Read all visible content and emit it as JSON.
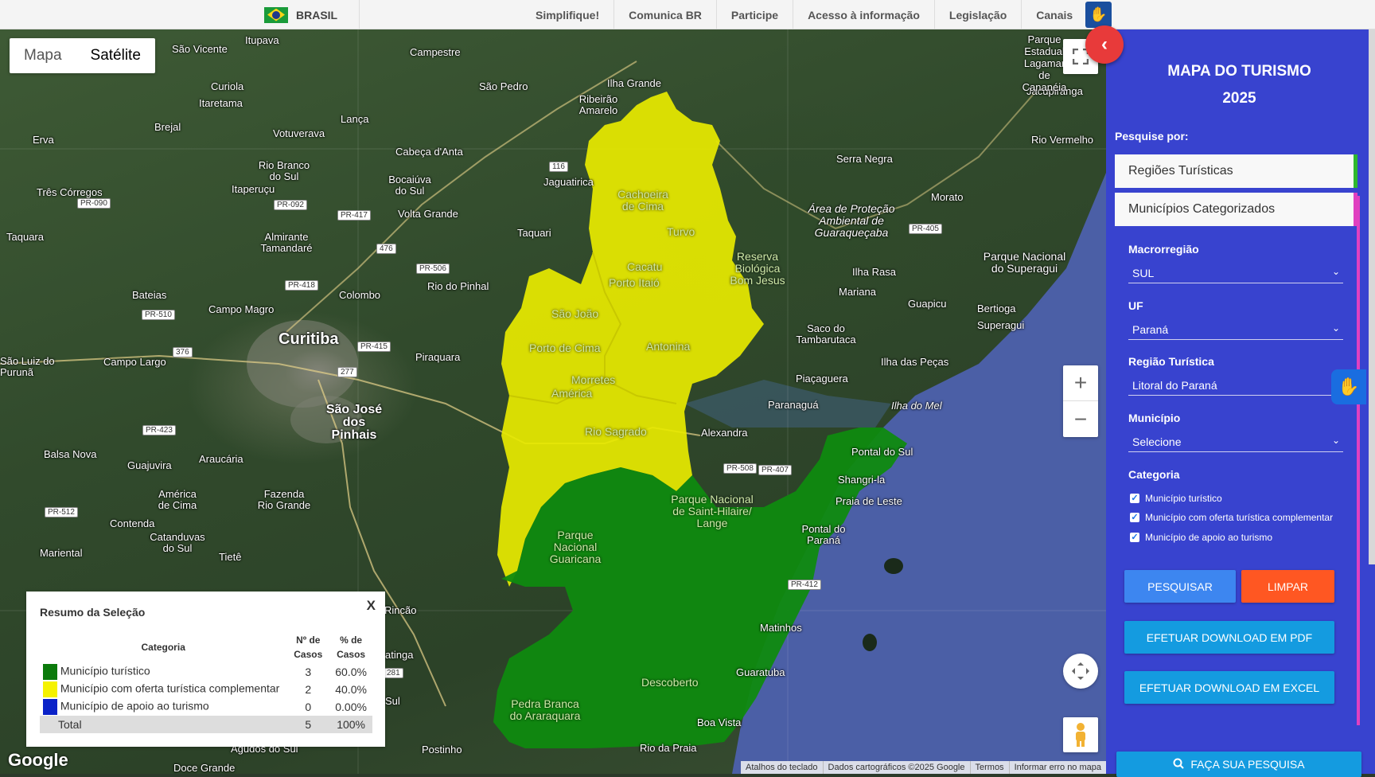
{
  "govbar": {
    "brand": "BRASIL",
    "links": [
      "Simplifique!",
      "Comunica BR",
      "Participe",
      "Acesso à informação",
      "Legislação",
      "Canais"
    ]
  },
  "map": {
    "types": [
      "Mapa",
      "Satélite"
    ],
    "active_type": "Satélite",
    "labels": [
      {
        "text": "Curitiba",
        "cls": "big"
      },
      {
        "text": "São José dos Pinhais",
        "cls": "mid"
      },
      {
        "text": "São Vicente"
      },
      {
        "text": "Itupava"
      },
      {
        "text": "Campestre"
      },
      {
        "text": "Ilha Grande"
      },
      {
        "text": "São Pedro"
      },
      {
        "text": "Ribeirão Amarelo"
      },
      {
        "text": "Curiola"
      },
      {
        "text": "Itaretama"
      },
      {
        "text": "Brejal"
      },
      {
        "text": "Votuverava"
      },
      {
        "text": "Lança"
      },
      {
        "text": "Cabeça d'Anta"
      },
      {
        "text": "Jaguatirica"
      },
      {
        "text": "Erva"
      },
      {
        "text": "Rio Branco do Sul"
      },
      {
        "text": "Itaperuçu"
      },
      {
        "text": "Bocaiúva do Sul"
      },
      {
        "text": "Volta Grande"
      },
      {
        "text": "Três Córregos"
      },
      {
        "text": "Taquara"
      },
      {
        "text": "Almirante Tamandaré"
      },
      {
        "text": "Taquari"
      },
      {
        "text": "Rio do Pinhal"
      },
      {
        "text": "Colombo"
      },
      {
        "text": "Campo Magro"
      },
      {
        "text": "Bateias"
      },
      {
        "text": "Campo Largo"
      },
      {
        "text": "São Luiz do Purunã"
      },
      {
        "text": "Piraquara"
      },
      {
        "text": "Balsa Nova"
      },
      {
        "text": "Guajuvira"
      },
      {
        "text": "Araucária"
      },
      {
        "text": "América de Cima"
      },
      {
        "text": "Fazenda Rio Grande"
      },
      {
        "text": "Contenda"
      },
      {
        "text": "Catanduvas do Sul"
      },
      {
        "text": "Tietê"
      },
      {
        "text": "Mariental"
      },
      {
        "text": "Serra Negra"
      },
      {
        "text": "Área de Proteção Ambiental de Guaraqueçaba"
      },
      {
        "text": "Morato"
      },
      {
        "text": "Rio Vermelho"
      },
      {
        "text": "Jacupiranga"
      },
      {
        "text": "Parque Nacional do Superagui"
      },
      {
        "text": "Ilha Rasa"
      },
      {
        "text": "Mariana"
      },
      {
        "text": "Guapicu"
      },
      {
        "text": "Bertioga"
      },
      {
        "text": "Superagui"
      },
      {
        "text": "Saco do Tambarutaca"
      },
      {
        "text": "Ilha das Peças"
      },
      {
        "text": "Piaçaguera"
      },
      {
        "text": "Paranaguá"
      },
      {
        "text": "Ilha do Mel"
      },
      {
        "text": "Alexandra"
      },
      {
        "text": "Pontal do Sul"
      },
      {
        "text": "Shangri-la"
      },
      {
        "text": "Praia de Leste"
      },
      {
        "text": "Pontal do Paraná"
      },
      {
        "text": "Matinhos"
      },
      {
        "text": "Guaratuba"
      },
      {
        "text": "Boa Vista"
      },
      {
        "text": "Rio da Praia"
      },
      {
        "text": "Postinho"
      },
      {
        "text": "Agudos do Sul"
      },
      {
        "text": "Doce Grande"
      },
      {
        "text": "Rincão"
      },
      {
        "text": "atinga"
      },
      {
        "text": "Sul"
      },
      {
        "text": "Parque Estadual Lagamar de Cananéia"
      }
    ],
    "zone_labels": [
      "Cachoeira de Cima",
      "Turvo",
      "Cacatu",
      "Porto Itaió",
      "Reserva Biológica Bom Jesus",
      "São João",
      "Porto de Cima",
      "Antonina",
      "Morretes",
      "América",
      "Rio Sagrado",
      "Parque Nacional de Saint-Hilaire/ Lange",
      "Parque Nacional Guaricana",
      "Descoberto",
      "Pedra Branca do Araraquara"
    ],
    "roads": [
      "PR-090",
      "PR-092",
      "PR-417",
      "476",
      "116",
      "PR-506",
      "PR-418",
      "PR-510",
      "376",
      "PR-415",
      "277",
      "PR-423",
      "PR-512",
      "PR-508",
      "PR-407",
      "PR-405",
      "PR-412",
      "281"
    ],
    "attribution": [
      "Atalhos do teclado",
      "Dados cartográficos ©2025 Google",
      "Termos",
      "Informar erro no mapa"
    ],
    "logo": "Google"
  },
  "summary": {
    "title": "Resumo da Seleção",
    "close": "X",
    "headers": {
      "category": "Categoria",
      "count": "Nº de Casos",
      "pct": "% de Casos"
    },
    "rows": [
      {
        "color": "#0b7a0b",
        "label": "Município turístico",
        "count": "3",
        "pct": "60.0%"
      },
      {
        "color": "#f5f200",
        "label": "Município com oferta turística complementar",
        "count": "2",
        "pct": "40.0%"
      },
      {
        "color": "#0a22c8",
        "label": "Município de apoio ao turismo",
        "count": "0",
        "pct": "0.00%"
      }
    ],
    "total": {
      "label": "Total",
      "count": "5",
      "pct": "100%"
    }
  },
  "panel": {
    "title_line1": "MAPA DO TURISMO",
    "title_line2": "2025",
    "search_by": "Pesquise por:",
    "accordion1": "Regiões Turísticas",
    "accordion2": "Municípios Categorizados",
    "macro_label": "Macrorregião",
    "macro_value": "SUL",
    "uf_label": "UF",
    "uf_value": "Paraná",
    "regiao_label": "Região Turística",
    "regiao_value": "Litoral do Paraná",
    "municipio_label": "Município",
    "municipio_value": "Selecione",
    "categoria_label": "Categoria",
    "checks": [
      "Município turístico",
      "Município com oferta turística complementar",
      "Município de apoio ao turismo"
    ],
    "btn_pesquisar": "PESQUISAR",
    "btn_limpar": "LIMPAR",
    "btn_pdf": "EFETUAR DOWNLOAD EM PDF",
    "btn_excel": "EFETUAR DOWNLOAD EM EXCEL",
    "btn_faca": "FAÇA SUA PESQUISA"
  },
  "colors": {
    "panel": "#3843cf",
    "turistico": "#0b7a0b",
    "complementar": "#f5f200",
    "limpar": "#ff5722",
    "pesquisar": "#3d86f0",
    "download": "#149be0"
  }
}
